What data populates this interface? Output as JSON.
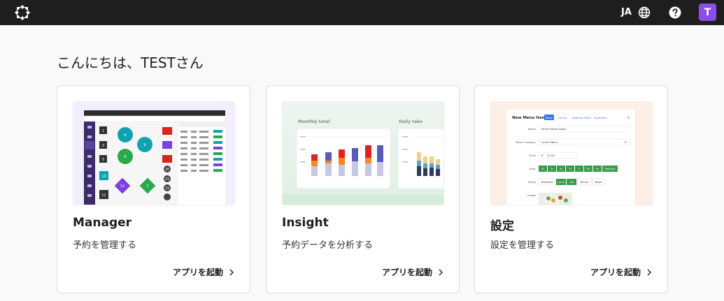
{
  "header": {
    "language": "JA",
    "avatar_initial": "T"
  },
  "greeting": "こんにちは、TESTさん",
  "cards": [
    {
      "title": "Manager",
      "description": "予約を管理する",
      "launch_label": "アプリを起動"
    },
    {
      "title": "Insight",
      "description": "予約データを分析する",
      "launch_label": "アプリを起動"
    },
    {
      "title": "設定",
      "description": "設定を管理する",
      "launch_label": "アプリを起動"
    }
  ],
  "thumbs": {
    "manager": {
      "table_numbers": [
        "1",
        "3",
        "5",
        "6",
        "9",
        "8",
        "7",
        "10",
        "11",
        "12",
        "20",
        "21",
        "22"
      ]
    },
    "insight": {
      "left_title": "Monthly total",
      "right_title": "Daily take"
    },
    "settings": {
      "form_title": "New Menu Item",
      "tabs": [
        "Basic",
        "Online",
        "Booking Rules",
        "Payments"
      ],
      "labels": [
        "Name",
        "Menu Category",
        "Price",
        "Days",
        "Meals",
        "Image"
      ],
      "name_value": "Penne Pesto Salad",
      "category_value": "Lunch Menu",
      "price_value": "12.00",
      "days": [
        "M",
        "Tu",
        "W",
        "Th",
        "F",
        "Sa",
        "Su",
        "Holidays"
      ],
      "meals": [
        "Breakfast",
        "Lunch",
        "Tea",
        "Dinner",
        "Night"
      ]
    }
  },
  "colors": {
    "topbar": "#1e1e1e",
    "avatar": "#8a4fe6",
    "teal": "#0fa3b1",
    "green": "#2aa84a",
    "purple": "#7b3fe4",
    "red": "#e1201f",
    "orange": "#f7891f",
    "indigo": "#5b5bb7"
  }
}
